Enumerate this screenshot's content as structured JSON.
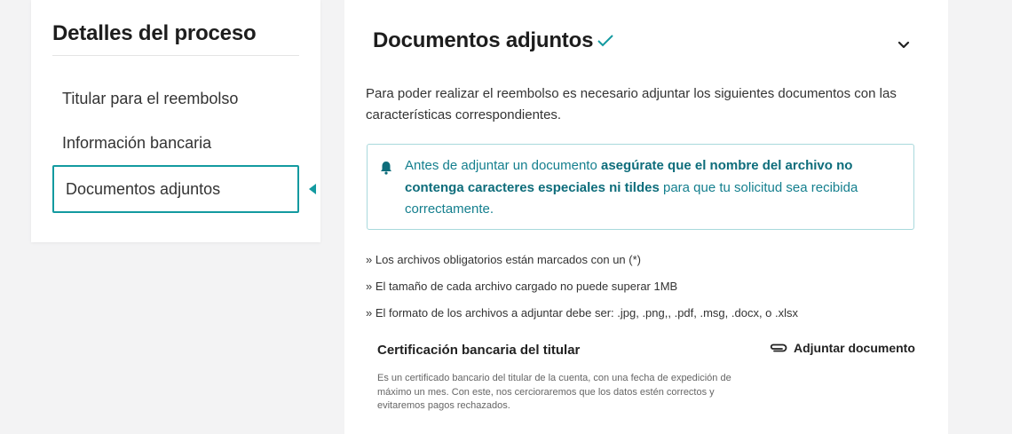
{
  "sidebar": {
    "title": "Detalles del proceso",
    "items": [
      {
        "label": "Titular para el reembolso",
        "active": false
      },
      {
        "label": "Información bancaria",
        "active": false
      },
      {
        "label": "Documentos adjuntos",
        "active": true
      }
    ]
  },
  "main": {
    "title": "Documentos adjuntos",
    "status_icon": "check-icon",
    "intro": "Para poder realizar el reembolso es necesario adjuntar los siguientes documentos con las características correspondientes.",
    "alert": {
      "icon": "bell-icon",
      "text_before": "Antes de adjuntar un documento ",
      "text_bold": "asegúrate que el nombre del archivo no contenga caracteres especiales ni tildes",
      "text_after": " para que tu solicitud sea recibida correctamente."
    },
    "rules": [
      "» Los archivos obligatorios están marcados con un (*)",
      "» El tamaño de cada archivo cargado no puede superar 1MB",
      "» El formato de los archivos a adjuntar debe ser: .jpg, .png,, .pdf, .msg, .docx, o .xlsx"
    ],
    "document": {
      "title": "Certificación bancaria del titular",
      "attach_label": "Adjuntar documento",
      "attach_icon": "paperclip-icon",
      "description": "Es un certificado bancario del titular de la cuenta, con una fecha de expedición de máximo un mes. Con este, nos cercioraremos que los datos estén correctos y evitaremos pagos rechazados."
    }
  },
  "colors": {
    "accent": "#139aa0",
    "alert_text": "#147f8e",
    "background": "#f3f3f4"
  }
}
